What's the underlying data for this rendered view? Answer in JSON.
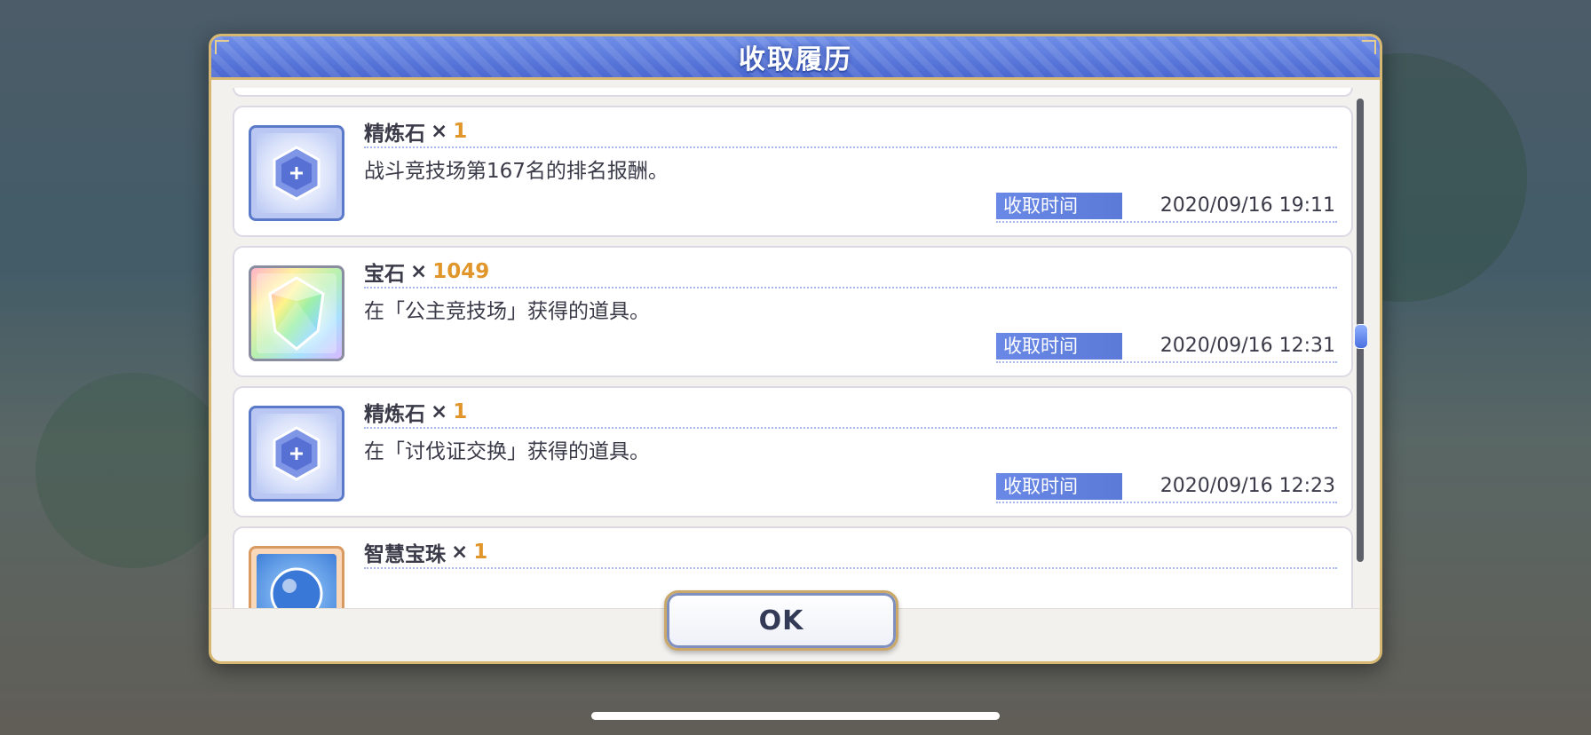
{
  "dialog": {
    "title": "收取履历",
    "ok_label": "OK"
  },
  "entries": [
    {
      "icon": "refine-stone-icon",
      "item_name": "精炼石",
      "times": "×",
      "quantity": "1",
      "description": "战斗竞技场第167名的排名报酬。",
      "time_label": "收取时间",
      "time_value": "2020/09/16 19:11"
    },
    {
      "icon": "gem-icon",
      "item_name": "宝石",
      "times": "×",
      "quantity": "1049",
      "description": "在「公主竞技场」获得的道具。",
      "time_label": "收取时间",
      "time_value": "2020/09/16 12:31"
    },
    {
      "icon": "refine-stone-icon",
      "item_name": "精炼石",
      "times": "×",
      "quantity": "1",
      "description": "在「讨伐证交换」获得的道具。",
      "time_label": "收取时间",
      "time_value": "2020/09/16 12:23"
    },
    {
      "icon": "wisdom-orb-icon",
      "item_name": "智慧宝珠",
      "times": "×",
      "quantity": "1"
    }
  ],
  "colors": {
    "header_blue": "#4a68d0",
    "quantity_orange": "#e0962a",
    "frame_gold": "#d7b873",
    "time_label_blue": "#5b7ad8"
  }
}
